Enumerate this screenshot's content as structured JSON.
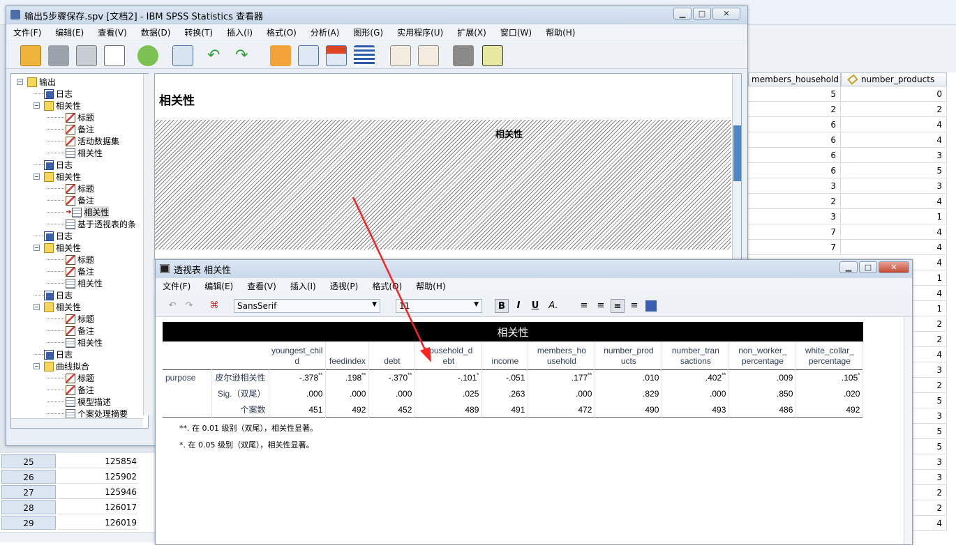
{
  "viewer": {
    "title": "输出5步骤保存.spv [文档2] - IBM SPSS Statistics 查看器",
    "menu": [
      "文件(F)",
      "编辑(E)",
      "查看(V)",
      "数据(D)",
      "转换(T)",
      "插入(I)",
      "格式(O)",
      "分析(A)",
      "图形(G)",
      "实用程序(U)",
      "扩展(X)",
      "窗口(W)",
      "帮助(H)"
    ]
  },
  "outline": [
    {
      "label": "输出",
      "level": 0,
      "icon": "folder",
      "pm": "−"
    },
    {
      "label": "日志",
      "level": 1,
      "icon": "log"
    },
    {
      "label": "相关性",
      "level": 1,
      "icon": "folder",
      "pm": "−"
    },
    {
      "label": "标题",
      "level": 2,
      "icon": "doc"
    },
    {
      "label": "备注",
      "level": 2,
      "icon": "doc"
    },
    {
      "label": "活动数据集",
      "level": 2,
      "icon": "doc"
    },
    {
      "label": "相关性",
      "level": 2,
      "icon": "tbl"
    },
    {
      "label": "日志",
      "level": 1,
      "icon": "log"
    },
    {
      "label": "相关性",
      "level": 1,
      "icon": "folder",
      "pm": "−"
    },
    {
      "label": "标题",
      "level": 2,
      "icon": "doc"
    },
    {
      "label": "备注",
      "level": 2,
      "icon": "doc"
    },
    {
      "label": "相关性",
      "level": 2,
      "icon": "tbl",
      "selected": true
    },
    {
      "label": "基于透视表的条",
      "level": 2,
      "icon": "tbl"
    },
    {
      "label": "日志",
      "level": 1,
      "icon": "log"
    },
    {
      "label": "相关性",
      "level": 1,
      "icon": "folder",
      "pm": "−"
    },
    {
      "label": "标题",
      "level": 2,
      "icon": "doc"
    },
    {
      "label": "备注",
      "level": 2,
      "icon": "doc"
    },
    {
      "label": "相关性",
      "level": 2,
      "icon": "tbl"
    },
    {
      "label": "日志",
      "level": 1,
      "icon": "log"
    },
    {
      "label": "相关性",
      "level": 1,
      "icon": "folder",
      "pm": "−"
    },
    {
      "label": "标题",
      "level": 2,
      "icon": "doc"
    },
    {
      "label": "备注",
      "level": 2,
      "icon": "doc"
    },
    {
      "label": "相关性",
      "level": 2,
      "icon": "tbl"
    },
    {
      "label": "日志",
      "level": 1,
      "icon": "log"
    },
    {
      "label": "曲线拟合",
      "level": 1,
      "icon": "folder",
      "pm": "−"
    },
    {
      "label": "标题",
      "level": 2,
      "icon": "doc"
    },
    {
      "label": "备注",
      "level": 2,
      "icon": "doc"
    },
    {
      "label": "模型描述",
      "level": 2,
      "icon": "tbl"
    },
    {
      "label": "个案处理摘要",
      "level": 2,
      "icon": "tbl"
    }
  ],
  "content": {
    "heading": "相关性"
  },
  "pivot": {
    "title": "透视表 相关性",
    "menu": [
      "文件(F)",
      "编辑(E)",
      "查看(V)",
      "插入(I)",
      "透视(P)",
      "格式(O)",
      "帮助(H)"
    ],
    "font": "SansSerif",
    "size": "11",
    "table_title": "相关性",
    "row_group": "purpose",
    "columns": [
      "youngest_child",
      "feedindex",
      "debt",
      "household_debt",
      "income",
      "members_household",
      "number_products",
      "number_transactions",
      "non_worker_percentage",
      "white_collar_percentage"
    ],
    "column_display": [
      "youngest_chil\nd",
      "feedindex",
      "debt",
      "household_d\nebt",
      "income",
      "members_ho\nusehold",
      "number_prod\nucts",
      "number_tran\nsactions",
      "non_worker_\npercentage",
      "white_collar_\npercentage"
    ],
    "rows": [
      {
        "label": "皮尔逊相关性",
        "values": [
          "-.378",
          ".198",
          "-.370",
          "-.101",
          "-.051",
          ".177",
          ".010",
          ".402",
          ".009",
          ".105"
        ],
        "marks": [
          "**",
          "**",
          "**",
          "*",
          "",
          "**",
          "",
          "**",
          "",
          "*"
        ]
      },
      {
        "label": "Sig.（双尾）",
        "values": [
          ".000",
          ".000",
          ".000",
          ".025",
          ".263",
          ".000",
          ".829",
          ".000",
          ".850",
          ".020"
        ],
        "marks": [
          "",
          "",
          "",
          "",
          "",
          "",
          "",
          "",
          "",
          ""
        ]
      },
      {
        "label": "个案数",
        "values": [
          "451",
          "492",
          "452",
          "489",
          "491",
          "472",
          "490",
          "493",
          "486",
          "492"
        ],
        "marks": [
          "",
          "",
          "",
          "",
          "",
          "",
          "",
          "",
          "",
          ""
        ]
      }
    ],
    "footnotes": [
      "**. 在 0.01 级别（双尾），相关性显著。",
      "*. 在 0.05 级别（双尾），相关性显著。"
    ]
  },
  "data_editor": {
    "headers": [
      "members_household",
      "number_products"
    ],
    "members_household": [
      "5",
      "2",
      "6",
      "6",
      "6",
      "6",
      "3",
      "2",
      "3",
      "7",
      "7"
    ],
    "number_products": [
      "0",
      "2",
      "4",
      "4",
      "3",
      "5",
      "3",
      "4",
      "1",
      "4",
      "4",
      "4",
      "1",
      "4",
      "1",
      "2",
      "2",
      "4",
      "3",
      "2",
      "5",
      "3",
      "5",
      "5",
      "3",
      "3",
      "2",
      "2",
      "4"
    ],
    "row_ids": [
      {
        "n": "25",
        "v": "125854"
      },
      {
        "n": "26",
        "v": "125902"
      },
      {
        "n": "27",
        "v": "125946"
      },
      {
        "n": "28",
        "v": "126017"
      },
      {
        "n": "29",
        "v": "126019"
      }
    ]
  }
}
